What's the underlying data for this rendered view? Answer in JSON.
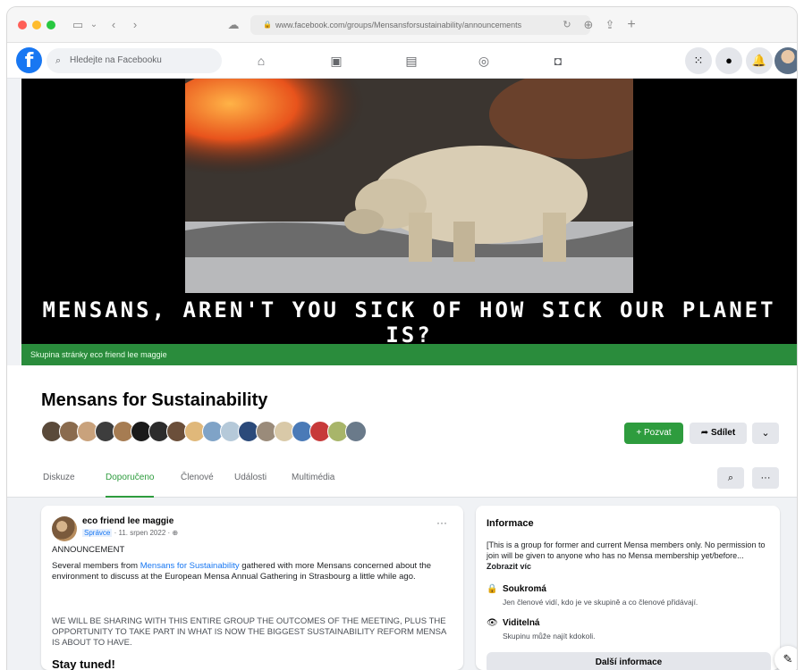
{
  "browser": {
    "url": "www.facebook.com/groups/Mensansforsustainability/announcements",
    "back_icon": "chevron-left-icon",
    "forward_icon": "chevron-right-icon"
  },
  "facebook_nav": {
    "logo": "f",
    "search_placeholder": "Hledejte na Facebooku",
    "icons": [
      "home-icon",
      "watch-icon",
      "marketplace-icon",
      "groups-icon",
      "gaming-icon"
    ]
  },
  "cover": {
    "headline": "MENSANS, AREN'T YOU SICK OF HOW SICK OUR PLANET IS?",
    "banner": "Skupina stránky eco friend lee maggie"
  },
  "group": {
    "name": "Mensans for Sustainability",
    "invite_label": "+ Pozvat",
    "share_label": "Sdílet",
    "more_label": "⌄",
    "member_colors": [
      "#5a4a3a",
      "#8a6b4e",
      "#c9a27c",
      "#3d3d3d",
      "#a67c52",
      "#1a1a1a",
      "#2c2c2c",
      "#6b4f3a",
      "#e0b87a",
      "#7fa3c7",
      "#b5c9d9",
      "#2b4a7a",
      "#9a8b7a",
      "#d9c9a8",
      "#4a7ab7",
      "#c73a3a",
      "#a8b56a",
      "#6a7a8a"
    ]
  },
  "tabs": [
    {
      "label": "Diskuze"
    },
    {
      "label": "Doporučeno"
    },
    {
      "label": "Členové"
    },
    {
      "label": "Události"
    },
    {
      "label": "Multimédia"
    }
  ],
  "post": {
    "author": "eco friend lee maggie",
    "role": "Správce",
    "date": "· 11. srpen 2022 ·",
    "header": "ANNOUNCEMENT",
    "body_pre": "Several members from ",
    "body_link": "Mensans for Sustainability",
    "body_post": " gathered with more Mensans concerned about the environment to discuss at the European Mensa Annual Gathering in Strasbourg a little while ago.",
    "caps": "WE WILL BE SHARING WITH THIS ENTIRE GROUP THE OUTCOMES OF THE MEETING, PLUS THE OPPORTUNITY TO TAKE PART IN WHAT IS NOW THE BIGGEST SUSTAINABILITY REFORM MENSA IS ABOUT TO HAVE.",
    "closing": "Stay tuned!"
  },
  "info": {
    "title": "Informace",
    "desc": "[This is a group for former and current Mensa members only. No permission to join will be given to anyone who has no Mensa membership yet/before...",
    "see_more": "Zobrazit víc",
    "private_title": "Soukromá",
    "private_sub": "Jen členové vidí, kdo je ve skupině a co členové přidávají.",
    "visible_title": "Viditelná",
    "visible_sub": "Skupinu může najít kdokoli.",
    "more_button": "Další informace"
  }
}
